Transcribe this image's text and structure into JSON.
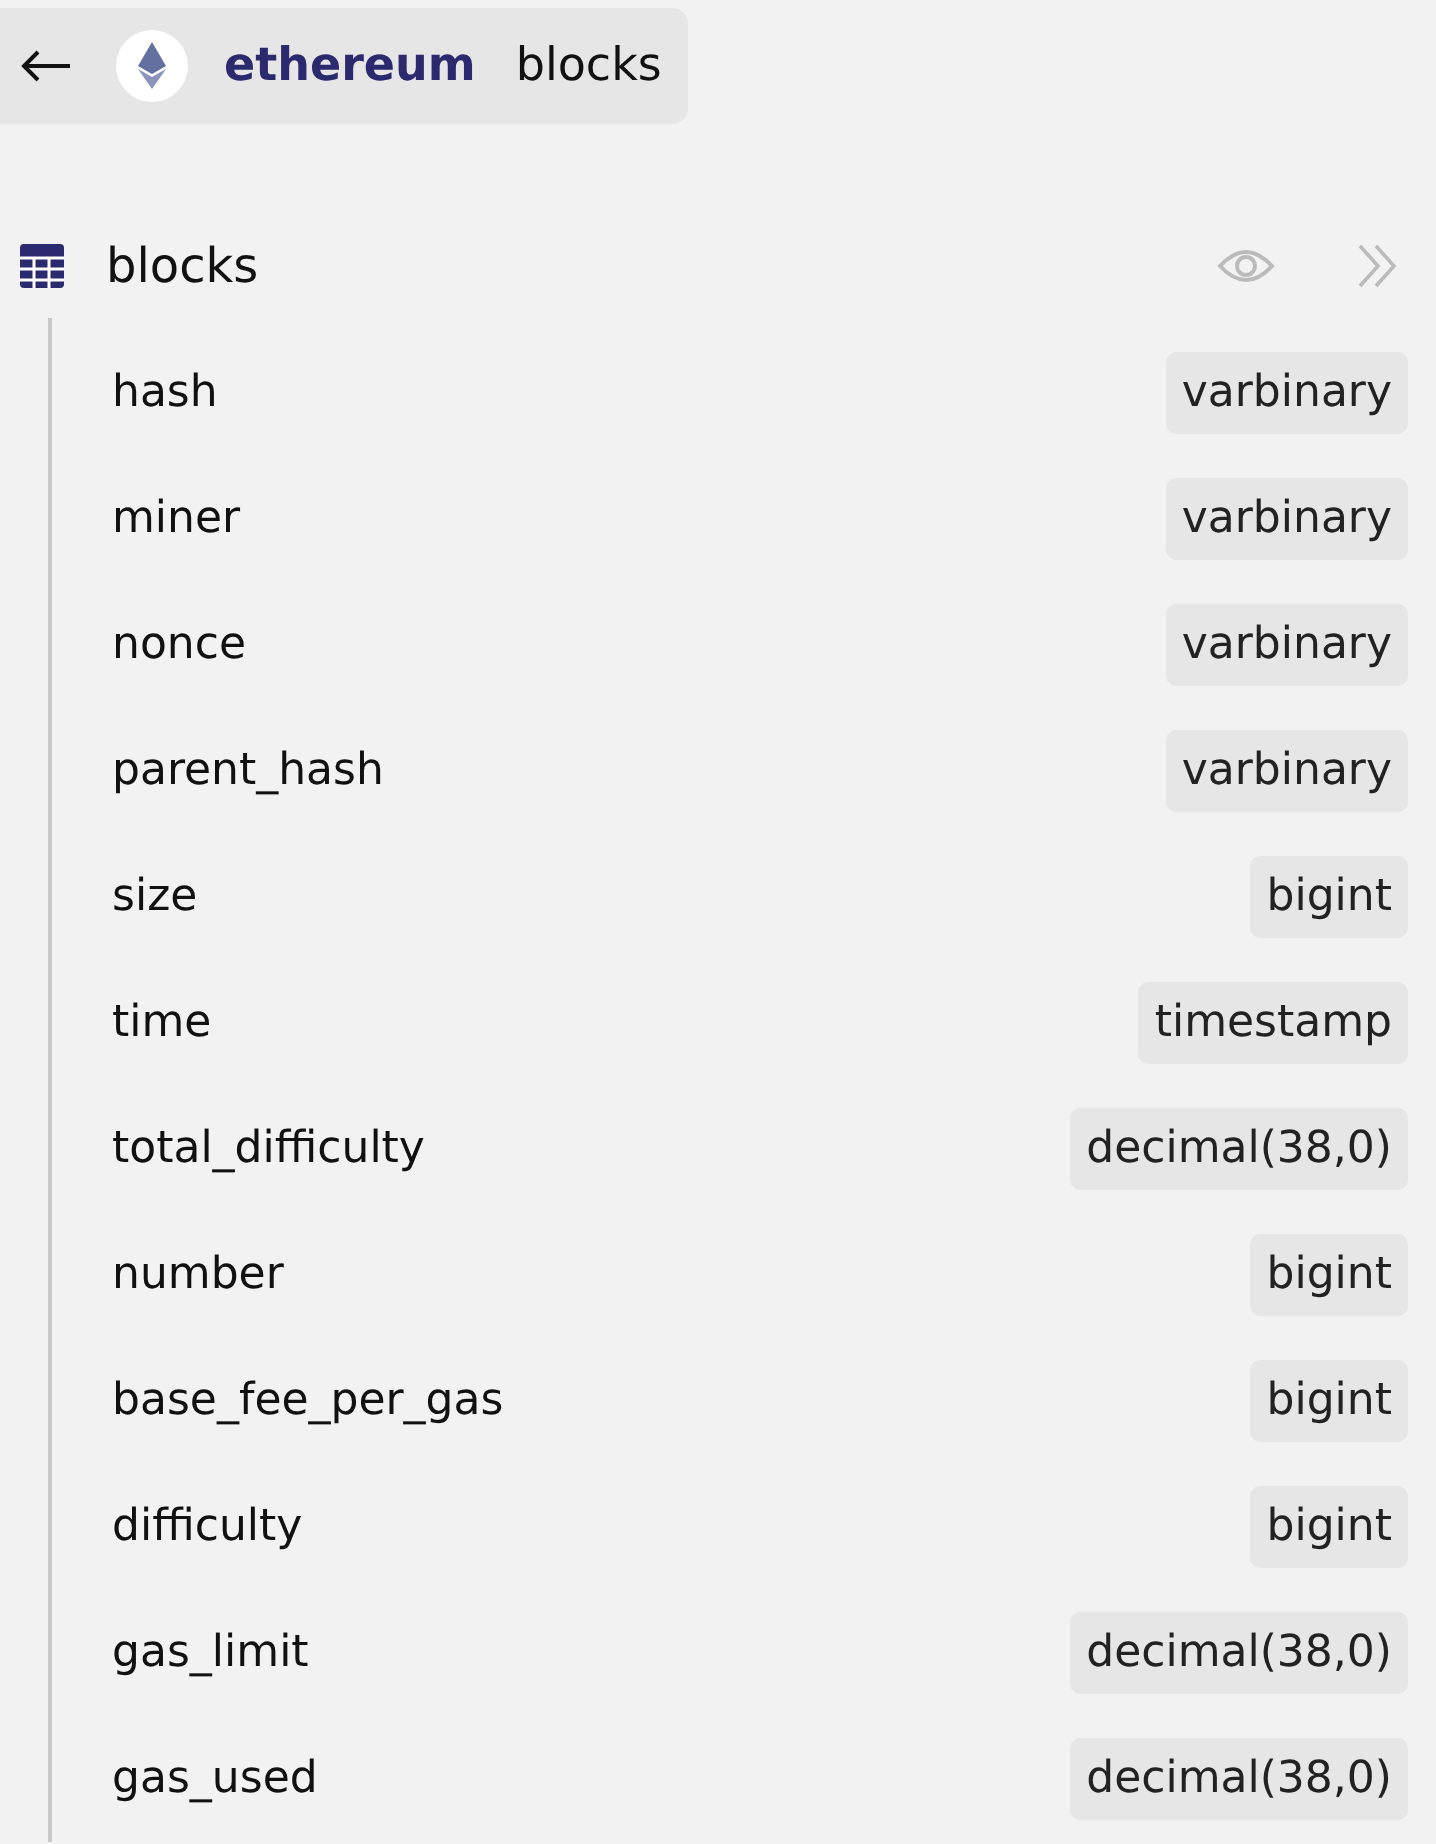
{
  "breadcrumb": {
    "namespace": "ethereum",
    "table": "blocks"
  },
  "table": {
    "name": "blocks",
    "columns": [
      {
        "name": "hash",
        "type": "varbinary"
      },
      {
        "name": "miner",
        "type": "varbinary"
      },
      {
        "name": "nonce",
        "type": "varbinary"
      },
      {
        "name": "parent_hash",
        "type": "varbinary"
      },
      {
        "name": "size",
        "type": "bigint"
      },
      {
        "name": "time",
        "type": "timestamp"
      },
      {
        "name": "total_difficulty",
        "type": "decimal(38,0)"
      },
      {
        "name": "number",
        "type": "bigint"
      },
      {
        "name": "base_fee_per_gas",
        "type": "bigint"
      },
      {
        "name": "difficulty",
        "type": "bigint"
      },
      {
        "name": "gas_limit",
        "type": "decimal(38,0)"
      },
      {
        "name": "gas_used",
        "type": "decimal(38,0)"
      }
    ]
  }
}
